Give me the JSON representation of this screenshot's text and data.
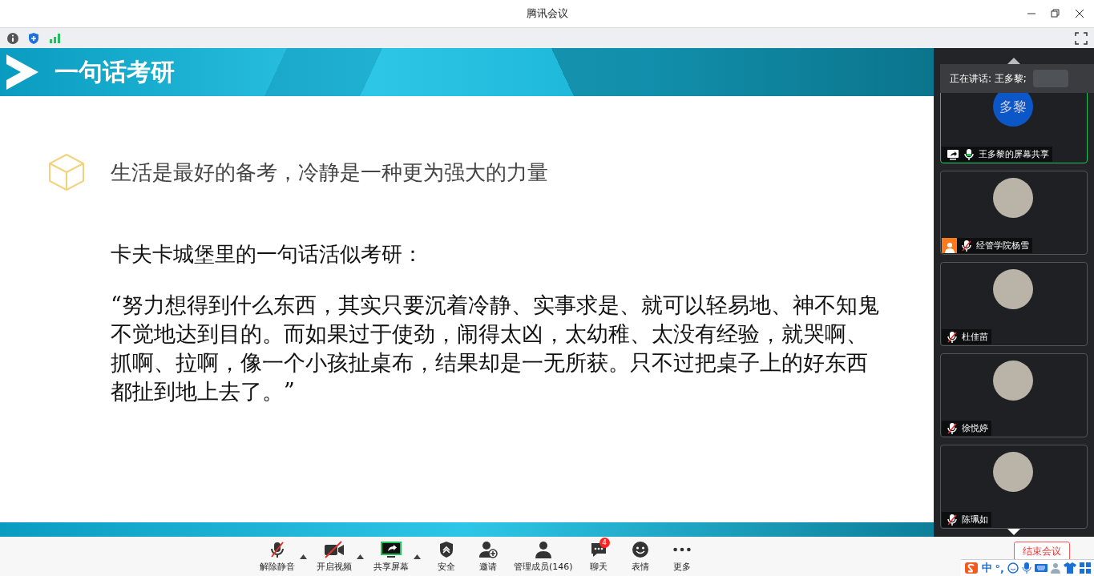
{
  "window": {
    "title": "腾讯会议"
  },
  "slide": {
    "title": "一句话考研",
    "subtitle": "生活是最好的备考，冷静是一种更为强大的力量",
    "intro": "卡夫卡城堡里的一句话活似考研：",
    "quote": "“努力想得到什么东西，其实只要沉着冷静、实事求是、就可以轻易地、神不知鬼不觉地达到目的。而如果过于使劲，闹得太凶，太幼稚、太没有经验，就哭啊、抓啊、拉啊，像一个小孩扯桌布，结果却是一无所获。只不过把桌子上的好东西都扯到地上去了。”"
  },
  "speaking": {
    "label": "正在讲话: 王多黎;"
  },
  "participants": [
    {
      "name": "王多黎的屏幕共享",
      "kind": "initials",
      "initials": "多黎",
      "speaking": true,
      "sharing": true,
      "is_self": false,
      "mic_muted": false
    },
    {
      "name": "经管学院杨雪",
      "kind": "photo",
      "speaking": false,
      "sharing": false,
      "is_self": true,
      "mic_muted": true
    },
    {
      "name": "杜佳苗",
      "kind": "photo",
      "speaking": false,
      "sharing": false,
      "is_self": false,
      "mic_muted": true
    },
    {
      "name": "徐悦婷",
      "kind": "photo",
      "speaking": false,
      "sharing": false,
      "is_self": false,
      "mic_muted": true
    },
    {
      "name": "陈珮如",
      "kind": "photo",
      "speaking": false,
      "sharing": false,
      "is_self": false,
      "mic_muted": true
    }
  ],
  "toolbar": [
    {
      "label": "解除静音",
      "kind": "mic",
      "caret": true
    },
    {
      "label": "开启视频",
      "kind": "video",
      "caret": true
    },
    {
      "label": "共享屏幕",
      "kind": "share",
      "caret": true
    },
    {
      "label": "安全",
      "kind": "security",
      "caret": false
    },
    {
      "label": "邀请",
      "kind": "invite",
      "caret": false
    },
    {
      "label": "管理成员(146)",
      "kind": "members",
      "caret": false
    },
    {
      "label": "聊天",
      "kind": "chat",
      "caret": false,
      "badge": "4"
    },
    {
      "label": "表情",
      "kind": "emoji",
      "caret": false
    },
    {
      "label": "更多",
      "kind": "more",
      "caret": false
    }
  ],
  "end_button": "结束会议",
  "ime": {
    "mode": "中",
    "punct": "°,"
  }
}
